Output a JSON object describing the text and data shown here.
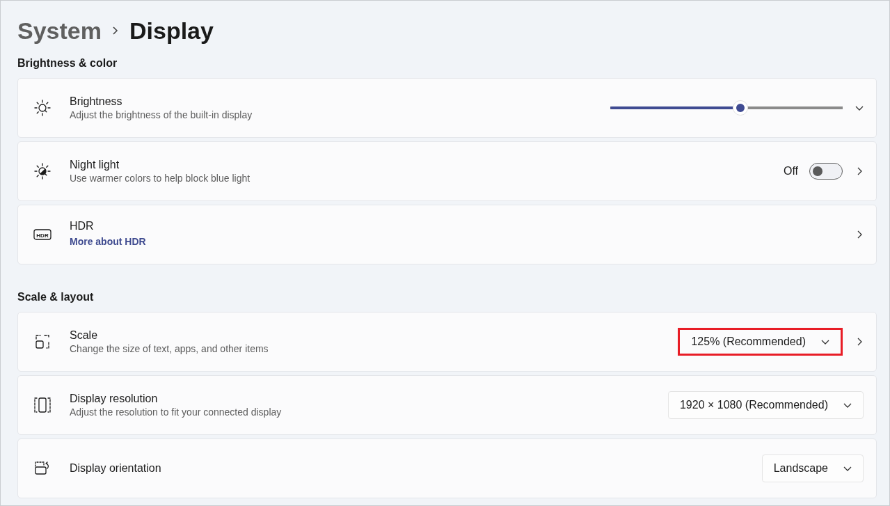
{
  "breadcrumb": [
    {
      "label": "System",
      "current": false
    },
    {
      "label": "Display",
      "current": true
    }
  ],
  "sections": [
    {
      "title": "Brightness & color",
      "rows": [
        {
          "kind": "expander",
          "title": "Brightness",
          "subtitle": "Adjust the brightness of the built-in display",
          "control": {
            "kind": "slider",
            "level": 0.56
          }
        },
        {
          "kind": "link",
          "title": "Night light",
          "subtitle": "Use warmer colors to help block blue light",
          "control": {
            "kind": "toggle",
            "label": "Off",
            "on": false
          }
        },
        {
          "kind": "link",
          "icon_label": "HDR",
          "title": "HDR",
          "link": "More about HDR"
        }
      ]
    },
    {
      "title": "Scale & layout",
      "rows": [
        {
          "kind": "link",
          "title": "Scale",
          "subtitle": "Change the size of text, apps, and other items",
          "control": {
            "kind": "dropdown",
            "value": "125% (Recommended)",
            "highlighted": true
          }
        },
        {
          "kind": "plain",
          "title": "Display resolution",
          "subtitle": "Adjust the resolution to fit your connected display",
          "control": {
            "kind": "dropdown",
            "value": "1920 × 1080 (Recommended)",
            "highlighted": false
          }
        },
        {
          "kind": "plain",
          "title": "Display orientation",
          "control": {
            "kind": "dropdown",
            "value": "Landscape",
            "highlighted": false
          }
        }
      ]
    }
  ]
}
